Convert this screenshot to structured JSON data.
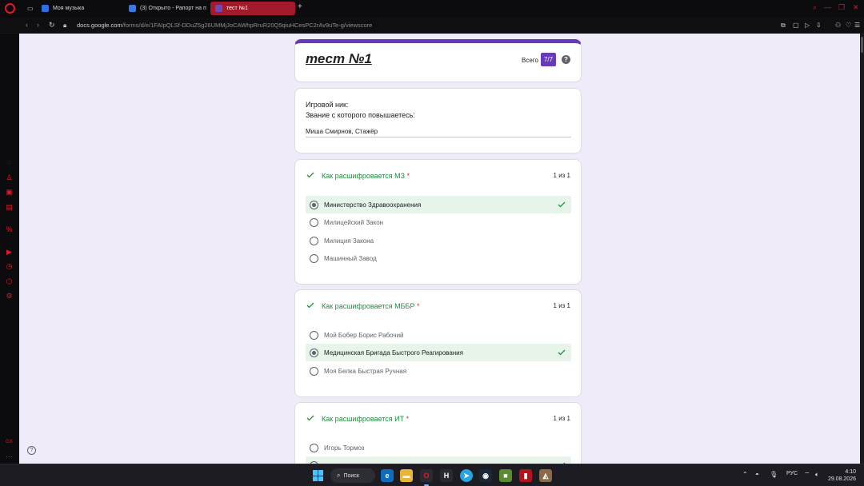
{
  "browser": {
    "tabs": [
      {
        "label": "Моя музыка",
        "fav_color": "#2f6fe0"
      },
      {
        "label": "(3) Открыто - Рапорт на п",
        "fav_color": "#3b78e7"
      },
      {
        "label": "тест №1",
        "fav_color": "#7248b9"
      }
    ],
    "url_domain": "docs.google.com",
    "url_path": "/forms/d/e/1FAIpQLSf-DDuZ5g26UMMjJoCAWhpRruR20Q5qiuHCesPC2rAv9uTe-g/viewscore",
    "accent": "#e3192b"
  },
  "form": {
    "title": "тест №1",
    "score_label": "Всего",
    "score_value": "7/7",
    "help": "?",
    "accent": "#673ab7"
  },
  "info": {
    "line1": "Игровой ник:",
    "line2": "Звание с которого повышаетесь:",
    "answer": "Миша Смирнов, Стажёр"
  },
  "questions": [
    {
      "title": "Как расшифровается МЗ",
      "required": "*",
      "score": "1 из 1",
      "options": [
        {
          "label": "Министерство Здравоохранения",
          "selected": true,
          "correct": true
        },
        {
          "label": "Милицейский Закон",
          "selected": false,
          "correct": false
        },
        {
          "label": "Милиция Закона",
          "selected": false,
          "correct": false
        },
        {
          "label": "Машинный Завод",
          "selected": false,
          "correct": false
        }
      ]
    },
    {
      "title": "Как расшифровается МББР",
      "required": "*",
      "score": "1 из 1",
      "options": [
        {
          "label": "Мой Бобер Борис Рабочий",
          "selected": false,
          "correct": false
        },
        {
          "label": "Медицинская Бригада Быстрого Реагирования",
          "selected": true,
          "correct": true
        },
        {
          "label": "Моя Белка Быстрая Ручная",
          "selected": false,
          "correct": false
        }
      ]
    },
    {
      "title": "Как расшифровается ИТ",
      "required": "*",
      "score": "1 из 1",
      "options": [
        {
          "label": "Игорь Тормоз",
          "selected": false,
          "correct": false
        },
        {
          "label": "",
          "selected": true,
          "correct": true
        }
      ]
    }
  ],
  "taskbar": {
    "search_label": "Поиск",
    "lang": "РУС",
    "time": "4:10",
    "date": "29.08.2026"
  }
}
